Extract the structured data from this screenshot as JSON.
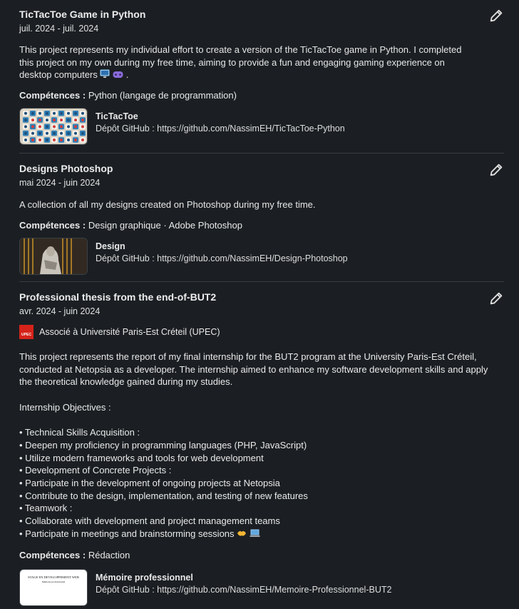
{
  "projects": [
    {
      "title": "TicTacToe Game in Python",
      "dates": "juil. 2024 - juil. 2024",
      "description": "This project represents my individual effort to create a version of the TicTacToe game in Python. I completed this project on my own during my free time, aiming to provide a fun and engaging gaming experience on desktop computers",
      "skills_label": "Compétences :",
      "skills": "Python (langage de programmation)",
      "media_title": "TicTacToe",
      "media_desc": "Dépôt GitHub : https://github.com/NassimEH/TicTacToe-Python"
    },
    {
      "title": "Designs Photoshop",
      "dates": "mai 2024 - juin 2024",
      "description": "A collection of all my designs created on Photoshop during my free time.",
      "skills_label": "Compétences :",
      "skills": "Design graphique · Adobe Photoshop",
      "media_title": "Design",
      "media_desc": "Dépôt GitHub : https://github.com/NassimEH/Design-Photoshop"
    },
    {
      "title": "Professional thesis from the end-of-BUT2",
      "dates": "avr. 2024 - juin 2024",
      "association": "Associé à Université Paris-Est Créteil (UPEC)",
      "upec_logo_text": "UPEC",
      "description": "This project represents the report of my final internship for the BUT2 program at the University Paris-Est Créteil, conducted at Netopsia as a developer. The internship aimed to enhance my software development skills and apply the theoretical knowledge gained during my studies.\n\nInternship Objectives :\n\n• Technical Skills Acquisition :\n • Deepen my proficiency in programming languages (PHP, JavaScript)\n • Utilize modern frameworks and tools for web development\n• Development of Concrete Projects :\n • Participate in the development of ongoing projects at Netopsia\n • Contribute to the design, implementation, and testing of new features\n• Teamwork :\n • Collaborate with development and project management teams\n • Participate in meetings and brainstorming sessions",
      "skills_label": "Compétences :",
      "skills": "Rédaction",
      "media_title": "Mémoire professionnel",
      "media_desc": "Dépôt GitHub : https://github.com/NassimEH/Memoire-Professionnel-BUT2",
      "thumb_heading": "STAGE EN DEVELOPPEMENT WEB",
      "thumb_sub": "Mémoire professionnel"
    }
  ],
  "icons": {
    "edit": "pencil-icon",
    "computer": "desktop-computer-emoji",
    "gamepad": "video-game-emoji",
    "handshake": "handshake-emoji",
    "laptop": "laptop-emoji"
  },
  "colors": {
    "background": "#1b1f23",
    "upec_red": "#d5231a"
  }
}
